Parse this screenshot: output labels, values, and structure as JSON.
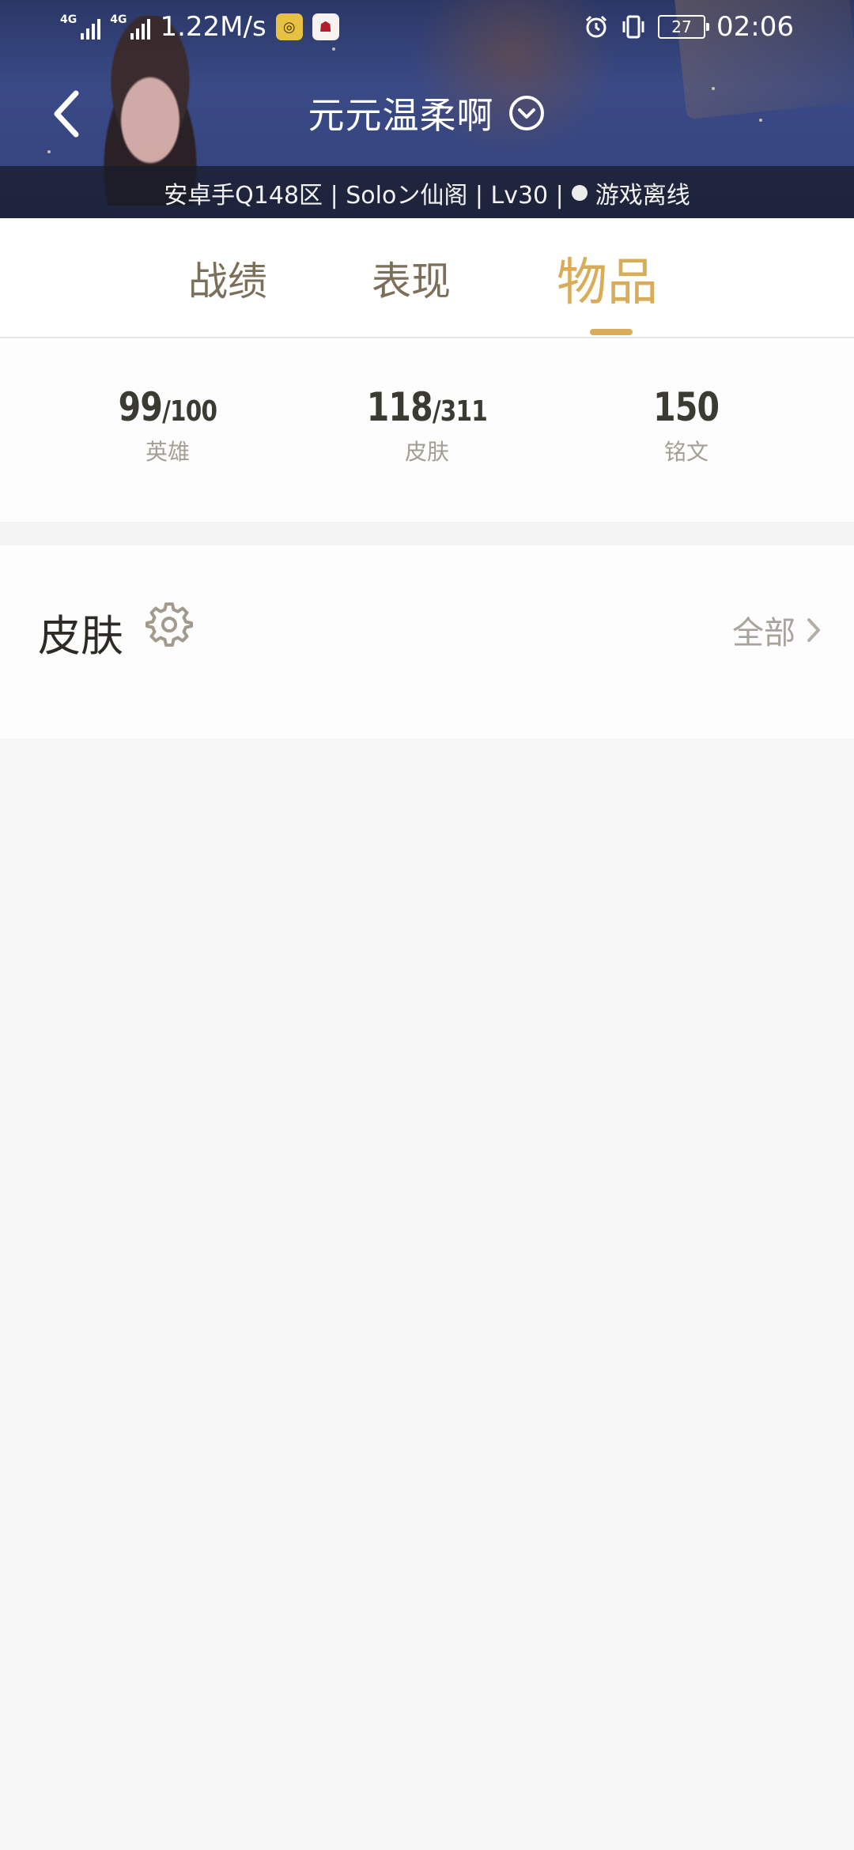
{
  "status_bar": {
    "net1": "4G",
    "net2": "4G",
    "speed": "1.22M/s",
    "battery": "27",
    "time": "02:06",
    "icons": [
      "signal-icon",
      "signal-icon",
      "app-icon",
      "app-icon",
      "alarm-icon",
      "vibrate-icon",
      "battery-icon"
    ]
  },
  "header": {
    "title": "元元温柔啊",
    "subinfo": "安卓手Q148区 | Soloン仙阁 | Lv30 |",
    "status": "游戏离线"
  },
  "tabs": [
    {
      "label": "战绩"
    },
    {
      "label": "表现"
    },
    {
      "label": "物品"
    }
  ],
  "active_tab": "物品",
  "stats": [
    {
      "value": "99",
      "total": "/100",
      "label": "英雄"
    },
    {
      "value": "118",
      "total": "/311",
      "label": "皮肤"
    },
    {
      "value": "150",
      "total": "",
      "label": "铭文"
    }
  ],
  "skins_section": {
    "title": "皮肤",
    "all_label": "全部"
  },
  "colors": {
    "accent": "#d9ad57",
    "tab_inactive": "#7c6f59",
    "stat_number": "#3b3a33",
    "muted_text": "#a39e94",
    "background": "#f6f6f6"
  }
}
